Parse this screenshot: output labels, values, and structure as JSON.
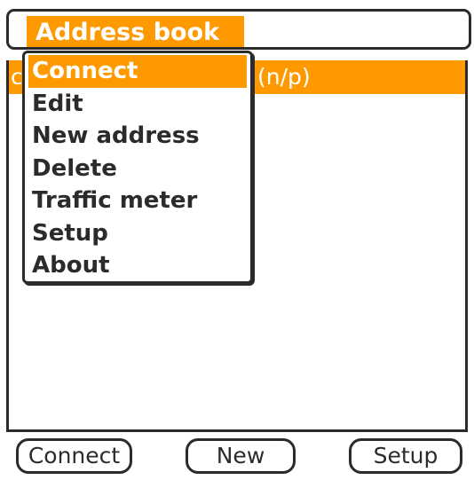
{
  "title_bar": {
    "title": "Address book"
  },
  "list": {
    "selected_row": {
      "name": "c",
      "status": "(n/p)"
    }
  },
  "menu": {
    "items": [
      {
        "label": "Connect",
        "selected": true
      },
      {
        "label": "Edit"
      },
      {
        "label": "New address"
      },
      {
        "label": "Delete"
      },
      {
        "label": "Traffic meter"
      },
      {
        "label": "Setup"
      },
      {
        "label": "About"
      }
    ]
  },
  "buttons": {
    "connect": "Connect",
    "new": "New",
    "setup": "Setup"
  },
  "colors": {
    "accent": "#ff9900",
    "foreground": "#2b2b2b",
    "background": "#ffffff"
  }
}
